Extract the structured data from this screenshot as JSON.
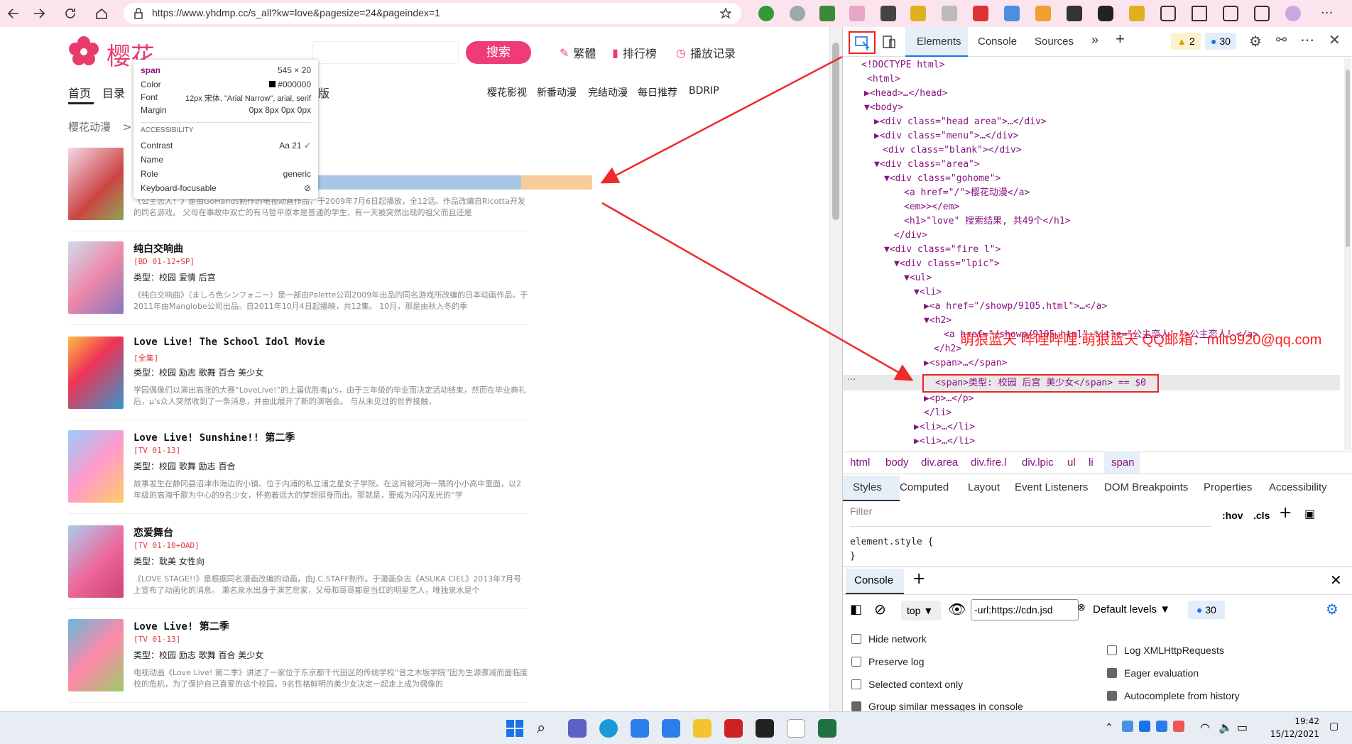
{
  "browser": {
    "url": "https://www.yhdmp.cc/s_all?kw=love&pagesize=24&pageindex=1"
  },
  "site": {
    "logo_text": "樱花",
    "search_button": "搜索",
    "header_links": [
      "繁體",
      "排行榜",
      "播放记录"
    ],
    "menu_left": [
      "首页",
      "目录"
    ],
    "menu_partial": "版",
    "menu_right": [
      "樱花影视",
      "新番动漫",
      "完结动漫",
      "每日推荐",
      "BDRIP"
    ],
    "breadcrumb": "樱花动漫",
    "breadcrumb_sep": ">"
  },
  "results": [
    {
      "title": "",
      "tag": "",
      "type": "类型：校园 后宫 美少女",
      "desc": "《公主恋人！》是由GoHands制作的电视动画作品，于2009年7月6日起播放，全12话。作品改编自Ricotta开发的同名游戏。 父母在事故中双亡的有马哲平原本是普通的学生，有一天被突然出现的祖父而且还是"
    },
    {
      "title": "纯白交响曲",
      "tag": "[BD 01-12+SP]",
      "type": "类型：校园 爱情 后宫",
      "desc": "《纯白交响曲》（ましろ色シンフォニー）是一部由Palette公司2009年出品的同名游戏所改编的日本动画作品。于2011年由Manglobe公司出品。自2011年10月4日起播映，共12集。 10月，那是由秋入冬的季"
    },
    {
      "title": "Love Live! The School Idol Movie",
      "tag": "[全集]",
      "type": "类型：校园 励志 歌舞 百合 美少女",
      "desc": "学园偶像们以演出高涨的大赛“LoveLive!”的上届优胜者μ's，由于三年级的毕业而决定活动结束，然而在毕业典礼后，μ's众人突然收到了一条消息，并由此展开了新的演唱会。 与从未见过的世界接触，"
    },
    {
      "title": "Love Live! Sunshine!! 第二季",
      "tag": "[TV 01-13]",
      "type": "类型：校园 歌舞 励志 百合",
      "desc": "故事发生在静冈县沼津市海边的小镇、位于内浦的私立浦之星女子学院。在这间被河海一隅的小小高中里面，以2年级的高海千歌为中心的9名少女，怀抱着远大的梦想挺身而出。那就是，要成为闪闪发光的“学"
    },
    {
      "title": "恋爱舞台",
      "tag": "[TV 01-10+OAD]",
      "type": "类型：耽美 女性向",
      "desc": "《LOVE STAGE!!》是根据同名漫画改编的动画，由J.C.STAFF制作。于漫画杂志《ASUKA CIEL》2013年7月号上宣布了动画化的消息。 濑名泉水出身于演艺世家，父母和哥哥都是当红的明星艺人，唯独泉水是个"
    },
    {
      "title": "Love Live! 第二季",
      "tag": "[TV 01-13]",
      "type": "类型：校园 励志 歌舞 百合 美少女",
      "desc": "电视动画《Love Live! 第二季》讲述了一家位于东京都千代田区的传统学校“音之木坂学院”因为生源骤减而面临废校的危机，为了保护自己喜爱的这个校园，9名性格鲜明的美少女决定一起走上成为偶像的"
    }
  ],
  "tooltip": {
    "tag": "span",
    "size": "545 × 20",
    "rows": [
      {
        "k": "Color",
        "v": "#000000"
      },
      {
        "k": "Font",
        "v": "12px 宋体, \"Arial Narrow\", arial, serif"
      },
      {
        "k": "Margin",
        "v": "0px 8px 0px 0px"
      }
    ],
    "section": "ACCESSIBILITY",
    "arows": [
      {
        "k": "Contrast",
        "v": "Aa  21"
      },
      {
        "k": "Name",
        "v": ""
      },
      {
        "k": "Role",
        "v": "generic"
      },
      {
        "k": "Keyboard-focusable",
        "v": ""
      }
    ]
  },
  "devtools": {
    "tabs": [
      "Elements",
      "Console",
      "Sources"
    ],
    "warn_count": "2",
    "msg_count": "30",
    "dom": [
      "<!DOCTYPE html>",
      "<html>",
      "<head>…</head>",
      "<body>",
      "<div class=\"head area\">…</div>",
      "<div class=\"menu\">…</div>",
      "<div class=\"blank\"></div>",
      "<div class=\"area\">",
      "<div class=\"gohome\">",
      "<a href=\"/\">樱花动漫</a>",
      "<em>></em>",
      "<h1>\"love\" 搜索结果, 共49个</h1>",
      "</div>",
      "<div class=\"fire l\">",
      "<div class=\"lpic\">",
      "<ul>",
      "<li>",
      "<a href=\"/showp/9105.html\">…</a>",
      "<h2>",
      "<a href=\"/showp/9105.html\" title=\"公主恋人！\">公主恋人！</a>",
      "</h2>",
      "<span>…</span>",
      "<span>类型: 校园 后宫 美少女</span> == $0",
      "<p>…</p>",
      "</li>",
      "<li>…</li>",
      "<li>…</li>"
    ],
    "breadcrumbs": [
      "html",
      "body",
      "div.area",
      "div.fire.l",
      "div.lpic",
      "ul",
      "li",
      "span"
    ],
    "subtabs": [
      "Styles",
      "Computed",
      "Layout",
      "Event Listeners",
      "DOM Breakpoints",
      "Properties",
      "Accessibility"
    ],
    "filter_placeholder": "Filter",
    "hov": ":hov",
    "cls": ".cls",
    "element_style": "element.style {",
    "element_style_close": "}",
    "console_tab": "Console",
    "context": "top",
    "console_filter": "-url:https://cdn.jsd",
    "levels": "Default levels",
    "console_count": "30",
    "checks_left": [
      {
        "label": "Hide network",
        "on": false
      },
      {
        "label": "Preserve log",
        "on": false
      },
      {
        "label": "Selected context only",
        "on": false
      },
      {
        "label": "Group similar messages in console",
        "on": true
      }
    ],
    "checks_right": [
      {
        "label": "Log XMLHttpRequests",
        "on": false
      },
      {
        "label": "Eager evaluation",
        "on": true
      },
      {
        "label": "Autocomplete from history",
        "on": true
      }
    ]
  },
  "watermark": "萌狼蓝天 哔哩哔哩:萌狼蓝天 QQ邮箱：mllt9920@qq.com",
  "taskbar": {
    "time": "19:42",
    "date": "15/12/2021"
  }
}
